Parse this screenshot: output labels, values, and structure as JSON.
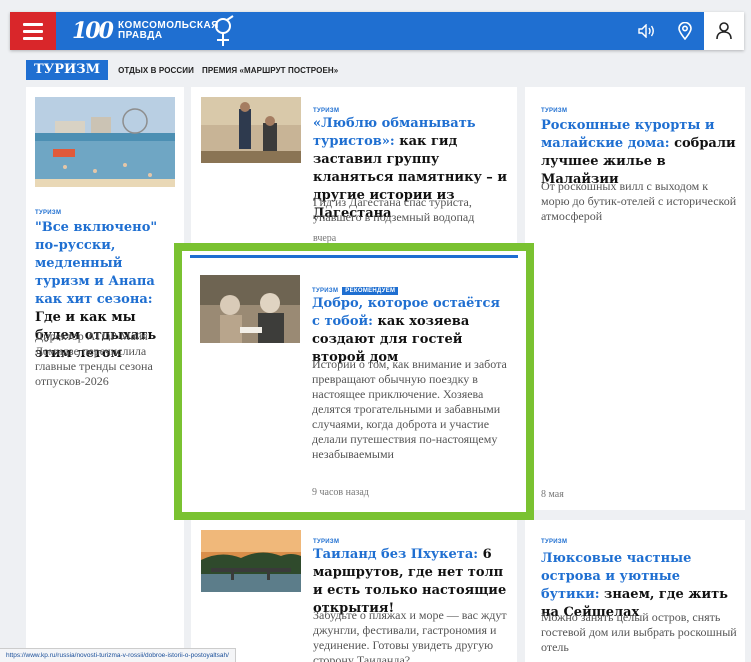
{
  "header": {
    "logo_number": "100",
    "logo_line1": "КОМСОМОЛЬСКАЯ",
    "logo_line2": "ПРАВДА",
    "accent": "#1f6fd1",
    "menu_color": "#d9262a"
  },
  "subnav": {
    "main": "ТУРИЗМ",
    "links": [
      "ОТДЫХ В РОССИИ",
      "ПРЕМИЯ «МАРШРУТ ПОСТРОЕН»"
    ]
  },
  "cards": {
    "anapa": {
      "tag": "ТУРИЗМ",
      "title_hl": "\"Все включено\" по-русски, медленный туризм и Анапа как хит сезона:",
      "title_rest": " Где и как мы будем отдыхать этим летом",
      "desc": "Директор АТОР Майя Ломидзе перечислила главные тренды сезона отпусков-2026"
    },
    "dagestan": {
      "tag": "ТУРИЗМ",
      "title_hl": "«Люблю обманывать туристов»:",
      "title_rest": " как гид заставил группу кланяться памятнику – и другие истории из Дагестана",
      "desc": "Гид из Дагестана спас туриста, упавшего в подземный водопад",
      "date": "вчера"
    },
    "malaysia": {
      "tag": "ТУРИЗМ",
      "title_hl": "Роскошные курорты и малайские дома:",
      "title_rest": " собрали лучшее жилье в Малайзии",
      "desc": "От роскошных вилл с выходом к морю до бутик-отелей с исторической атмосферой",
      "date": "8 мая"
    },
    "kindness": {
      "tag": "ТУРИЗМ",
      "tag2": "РЕКОМЕНДУЕМ",
      "title_hl": "Добро, которое остаётся с тобой:",
      "title_rest": " как хозяева создают для гостей второй дом",
      "desc": "Истории о том, как внимание и забота превращают обычную поездку в настоящее приключение. Хозяева делятся трогательными и забавными случаями, когда доброта и участие делали путешествия по-настоящему незабываемыми",
      "date": "9 часов назад"
    },
    "thailand": {
      "tag": "ТУРИЗМ",
      "title_hl": "Таиланд без Пхукета:",
      "title_rest": " 6 маршрутов, где нет толп и есть только настоящие открытия!",
      "desc": "Забудьте о пляжах и море — вас ждут джунгли, фестивали, гастрономия и уединение. Готовы увидеть другую сторону Таиланда?"
    },
    "seychelles": {
      "tag": "ТУРИЗМ",
      "title_hl": "Люксовые частные острова и уютные бутики:",
      "title_rest": " знаем, где жить на Сейшелах",
      "desc": "Можно занять целый остров, снять гостевой дом или выбрать роскошный отель"
    }
  },
  "status_url": "https://www.kp.ru/russia/novosti-turizma-v-rossii/dobroe-istorii-o-postoyaltsah/",
  "icons": [
    "menu-icon",
    "sound-icon",
    "location-icon",
    "user-icon"
  ]
}
